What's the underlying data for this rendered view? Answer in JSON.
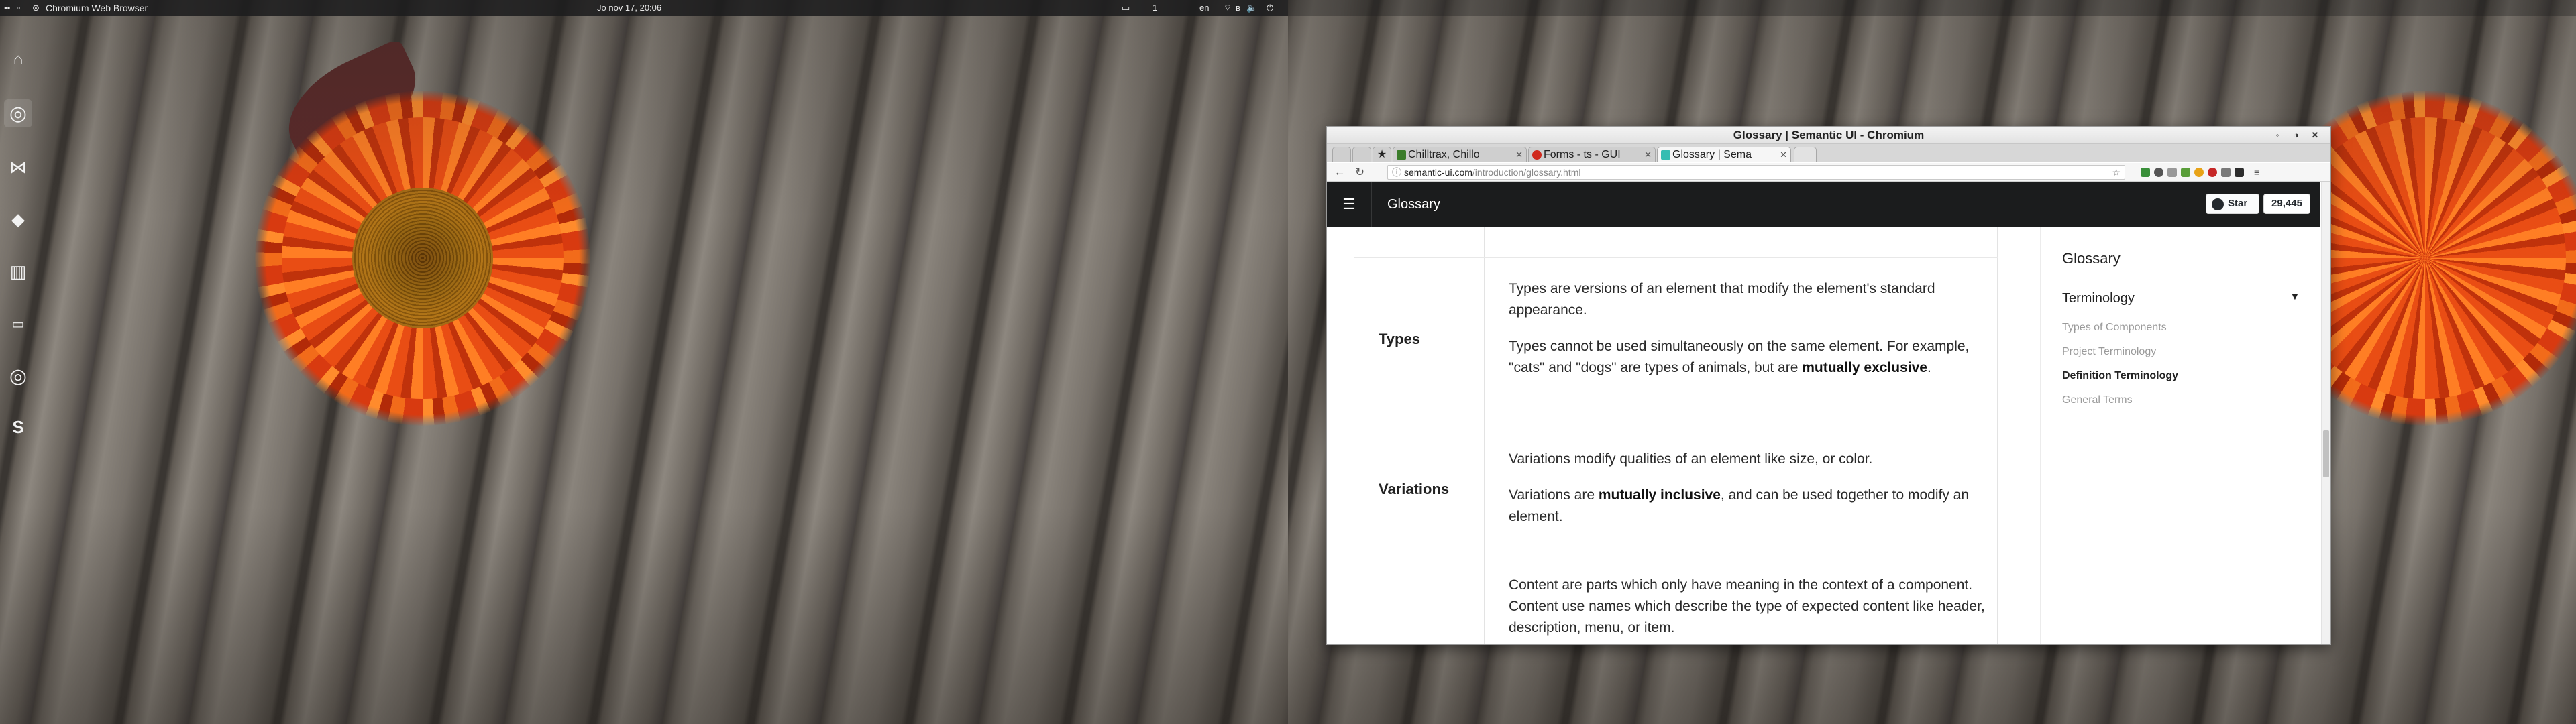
{
  "desktop": {
    "left_title": "Chromium Web Browser",
    "clock": "Jo nov 17, 20:06",
    "tray": {
      "keyboard": "en"
    },
    "dock": [
      {
        "name": "home-icon"
      },
      {
        "name": "chromium-icon"
      },
      {
        "name": "vscode-icon"
      },
      {
        "name": "git-icon"
      },
      {
        "name": "piano-icon"
      },
      {
        "name": "terminal-icon"
      },
      {
        "name": "chrome-icon"
      },
      {
        "name": "skype-icon"
      }
    ]
  },
  "window": {
    "title": "Glossary | Semantic UI - Chromium",
    "tabs": [
      {
        "label": "Chilltrax, Chillo",
        "color": "#3b7d2b"
      },
      {
        "label": "Forms - ts - GUI",
        "color": "#d02a1e"
      },
      {
        "label": "Glossary | Sema",
        "color": "#35bdb2"
      }
    ],
    "url": {
      "host": "semantic-ui.com",
      "path": "/introduction/glossary.html"
    },
    "colors": {
      "accent": "#35bdb2",
      "menu_bg": "#1b1c1d"
    }
  },
  "page": {
    "menu_title": "Glossary",
    "github": {
      "star_label": "Star",
      "star_count": "29,445"
    },
    "rows": [
      {
        "term": "Types",
        "paragraphs": [
          {
            "text": "Types are versions of an element that modify the element's standard appearance."
          },
          {
            "text": "Types cannot be used simultaneously on the same element. For example, \"cats\" and \"dogs\" are types of animals, but are ",
            "bold": "mutually exclusive",
            "after": "."
          }
        ]
      },
      {
        "term": "Variations",
        "paragraphs": [
          {
            "text": "Variations modify qualities of an element like size, or color."
          },
          {
            "text": "Variations are ",
            "bold": "mutually inclusive",
            "after": ", and can be used together to modify an element."
          }
        ]
      },
      {
        "term": "",
        "paragraphs": [
          {
            "text": "Content are parts which only have meaning in the context of a component. Content use names which describe the type of expected content like header, description, menu, or item."
          }
        ]
      }
    ],
    "rail": {
      "heading": "Glossary",
      "section": "Terminology",
      "links": [
        {
          "label": "Types of Components",
          "active": false
        },
        {
          "label": "Project Terminology",
          "active": false
        },
        {
          "label": "Definition Terminology",
          "active": true
        },
        {
          "label": "General Terms",
          "active": false
        }
      ]
    }
  }
}
